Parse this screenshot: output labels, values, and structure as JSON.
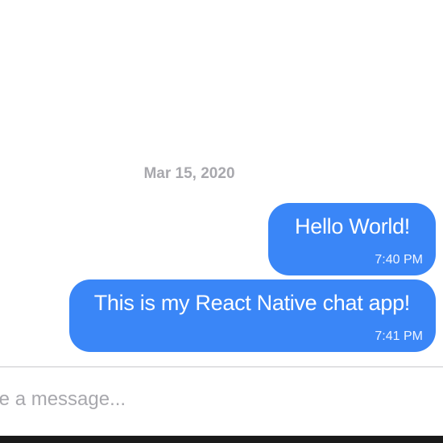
{
  "conversation": {
    "date_separator": "Mar 15, 2020",
    "messages": [
      {
        "text": "Hello World!",
        "time": "7:40 PM",
        "sender": "me"
      },
      {
        "text": "This is my React Native chat app!",
        "time": "7:41 PM",
        "sender": "me"
      }
    ]
  },
  "composer": {
    "placeholder": "Type a message..."
  },
  "colors": {
    "bubble": "#3a86f7",
    "date_text": "#a8a8ad",
    "placeholder": "#a8a8ad",
    "divider": "#c8c8cc"
  }
}
